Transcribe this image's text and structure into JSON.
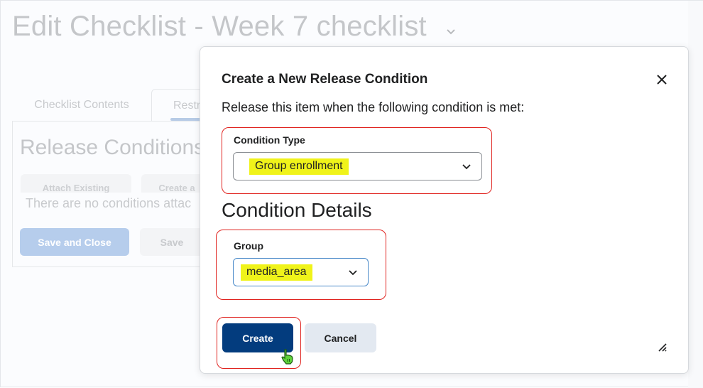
{
  "page": {
    "title": "Edit Checklist - Week 7 checklist",
    "title_menu_icon": "chevron-down-icon",
    "tabs": [
      {
        "label": "Checklist Contents",
        "active": false
      },
      {
        "label": "Restr",
        "active": true
      }
    ],
    "section_heading": "Release Conditions",
    "buttons": {
      "attach_existing": "Attach Existing",
      "create": "Create a"
    },
    "empty_message": "There are no conditions attac",
    "footer": {
      "save_and_close": "Save and Close",
      "save": "Save"
    }
  },
  "dialog": {
    "title": "Create a New Release Condition",
    "close_icon": "close-icon",
    "intro": "Release this item when the following condition is met:",
    "condition_type": {
      "label": "Condition Type",
      "value": "Group enrollment"
    },
    "details_heading": "Condition Details",
    "group": {
      "label": "Group",
      "value": "media_area"
    },
    "create_label": "Create",
    "cancel_label": "Cancel"
  },
  "colors": {
    "primary": "#033c7e",
    "highlight": "#f0f31a",
    "annotation": "#e0231f",
    "focus": "#4a8ac9"
  }
}
